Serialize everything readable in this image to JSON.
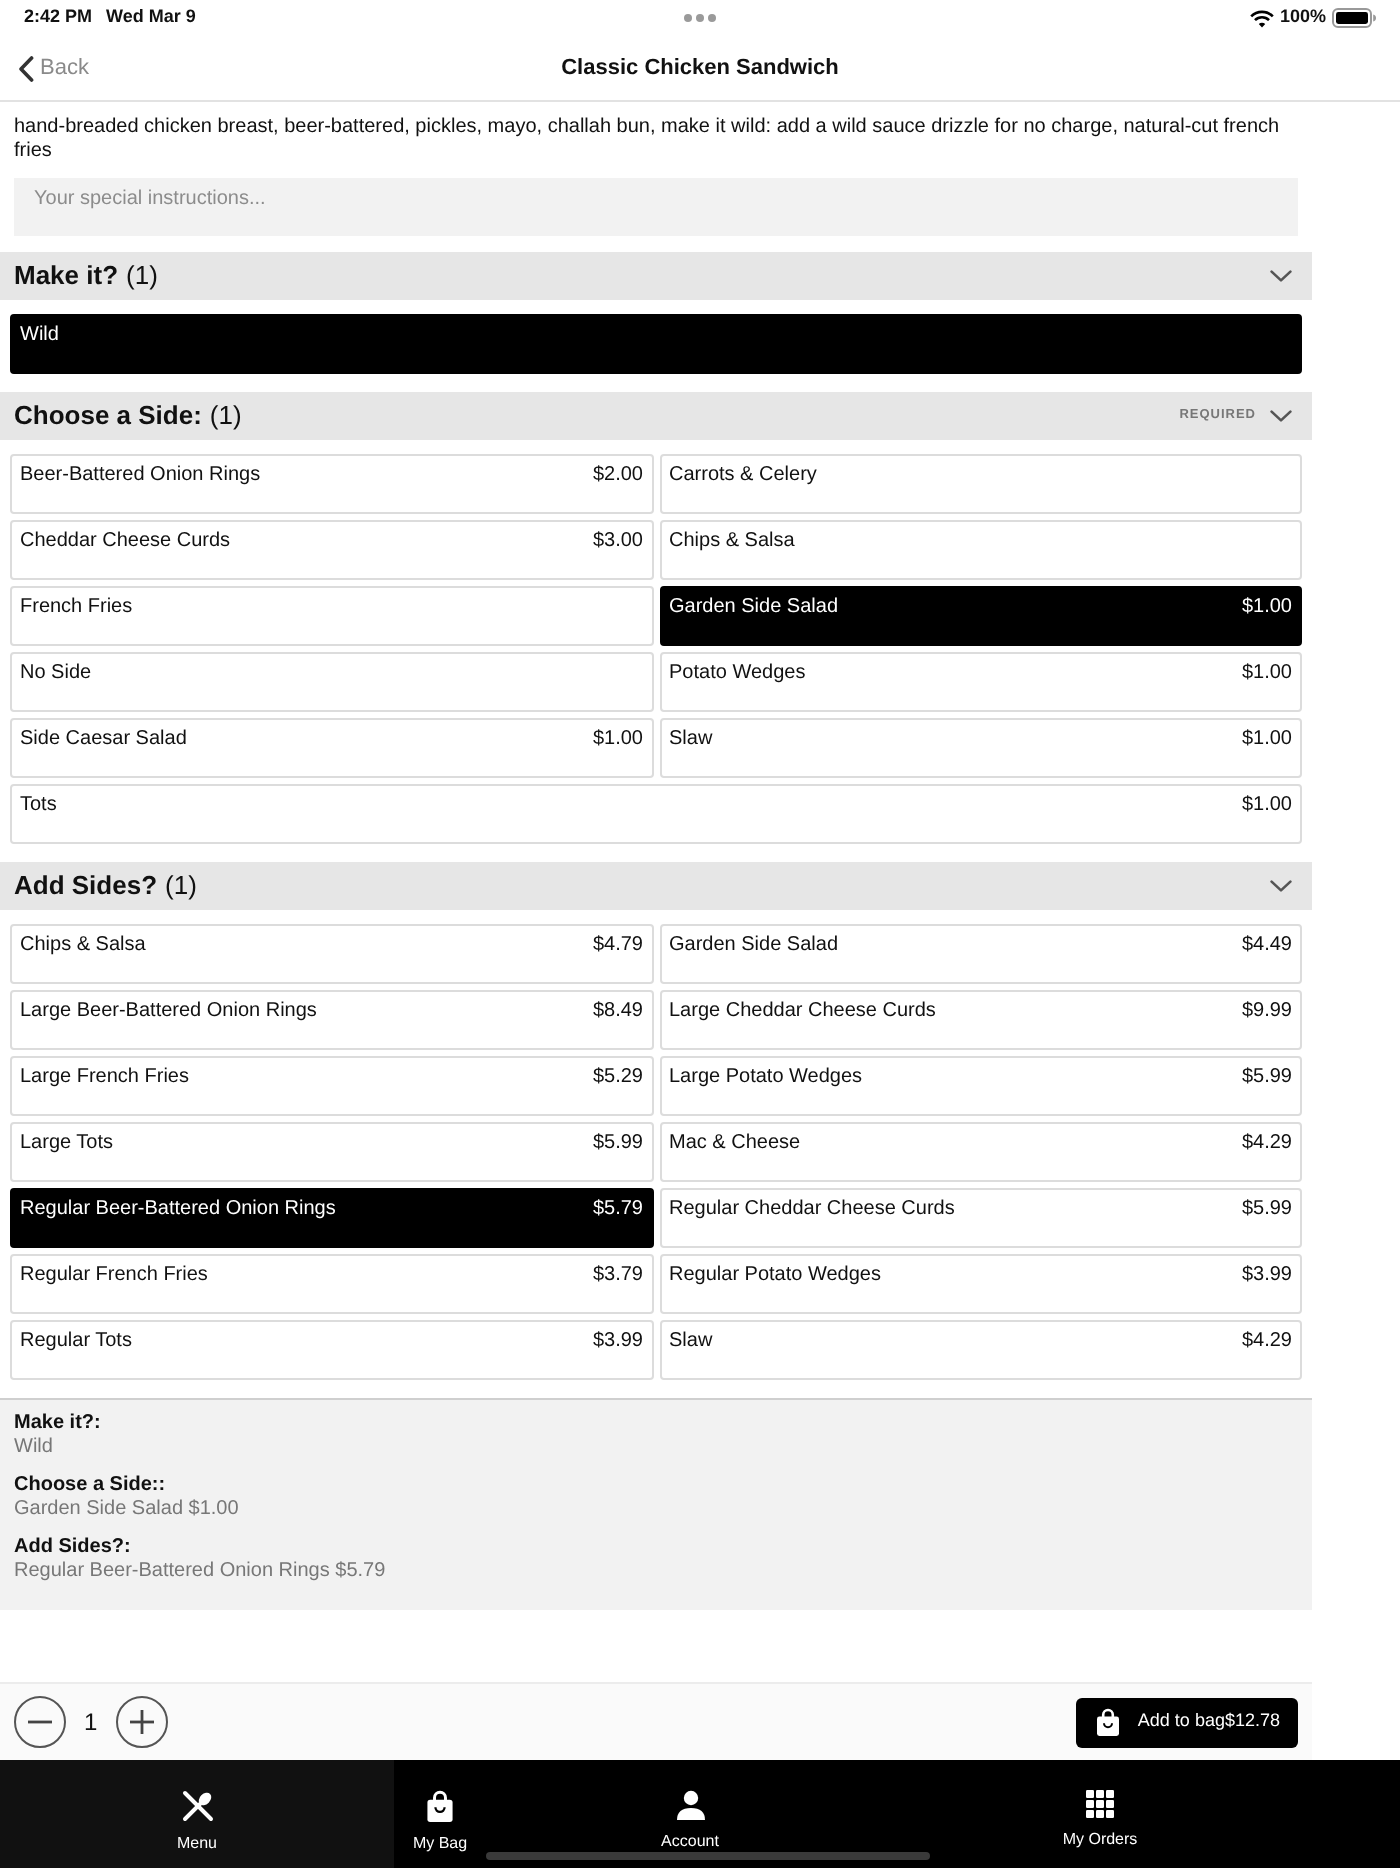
{
  "status_bar": {
    "time": "2:42 PM",
    "date": "Wed Mar 9",
    "battery": "100%"
  },
  "nav_bar": {
    "back": "Back",
    "title": "Classic Chicken Sandwich"
  },
  "description": "hand-breaded chicken breast, beer-battered, pickles, mayo, challah bun, make it wild: add a wild sauce drizzle for no charge, natural-cut french fries",
  "instructions": {
    "placeholder": "Your special instructions..."
  },
  "sections": [
    {
      "title": "Make it?",
      "count": "(1)",
      "options": [
        {
          "name": "Wild",
          "selected": true
        }
      ]
    },
    {
      "title": "Choose a Side:",
      "count": "(1)",
      "badge": "REQUIRED",
      "options": [
        {
          "name": "Beer-Battered Onion Rings",
          "price": "$2.00",
          "selected": false
        },
        {
          "name": "Carrots & Celery",
          "selected": false
        },
        {
          "name": "Cheddar Cheese Curds",
          "price": "$3.00",
          "selected": false
        },
        {
          "name": "Chips & Salsa",
          "selected": false
        },
        {
          "name": "French Fries",
          "selected": false
        },
        {
          "name": "Garden Side Salad",
          "price": "$1.00",
          "selected": true
        },
        {
          "name": "No Side",
          "selected": false
        },
        {
          "name": "Potato Wedges",
          "price": "$1.00",
          "selected": false
        },
        {
          "name": "Side Caesar Salad",
          "price": "$1.00",
          "selected": false
        },
        {
          "name": "Slaw",
          "price": "$1.00",
          "selected": false
        },
        {
          "name": "Tots",
          "price": "$1.00",
          "selected": false
        }
      ]
    },
    {
      "title": "Add Sides?",
      "count": "(1)",
      "options": [
        {
          "name": "Chips & Salsa",
          "price": "$4.79",
          "selected": false
        },
        {
          "name": "Garden Side Salad",
          "price": "$4.49",
          "selected": false
        },
        {
          "name": "Large Beer-Battered Onion Rings",
          "price": "$8.49",
          "selected": false
        },
        {
          "name": "Large Cheddar Cheese Curds",
          "price": "$9.99",
          "selected": false
        },
        {
          "name": "Large French Fries",
          "price": "$5.29",
          "selected": false
        },
        {
          "name": "Large Potato Wedges",
          "price": "$5.99",
          "selected": false
        },
        {
          "name": "Large Tots",
          "price": "$5.99",
          "selected": false
        },
        {
          "name": "Mac & Cheese",
          "price": "$4.29",
          "selected": false
        },
        {
          "name": "Regular Beer-Battered Onion Rings",
          "price": "$5.79",
          "selected": true
        },
        {
          "name": "Regular Cheddar Cheese Curds",
          "price": "$5.99",
          "selected": false
        },
        {
          "name": "Regular French Fries",
          "price": "$3.79",
          "selected": false
        },
        {
          "name": "Regular Potato Wedges",
          "price": "$3.99",
          "selected": false
        },
        {
          "name": "Regular Tots",
          "price": "$3.99",
          "selected": false
        },
        {
          "name": "Slaw",
          "price": "$4.29",
          "selected": false
        }
      ]
    }
  ],
  "summary": [
    {
      "label": "Make it?:",
      "value": "Wild"
    },
    {
      "label": "Choose a Side::",
      "value": "Garden Side Salad $1.00"
    },
    {
      "label": "Add Sides?:",
      "value": "Regular Beer-Battered Onion Rings $5.79"
    }
  ],
  "footer": {
    "quantity": "1",
    "add_button": "Add to bag$12.78"
  },
  "tab_bar": [
    {
      "label": "Menu",
      "selected": true
    },
    {
      "label": "My Bag",
      "selected": false
    },
    {
      "label": "Account",
      "selected": false
    },
    {
      "label": "My Orders",
      "selected": false
    }
  ]
}
